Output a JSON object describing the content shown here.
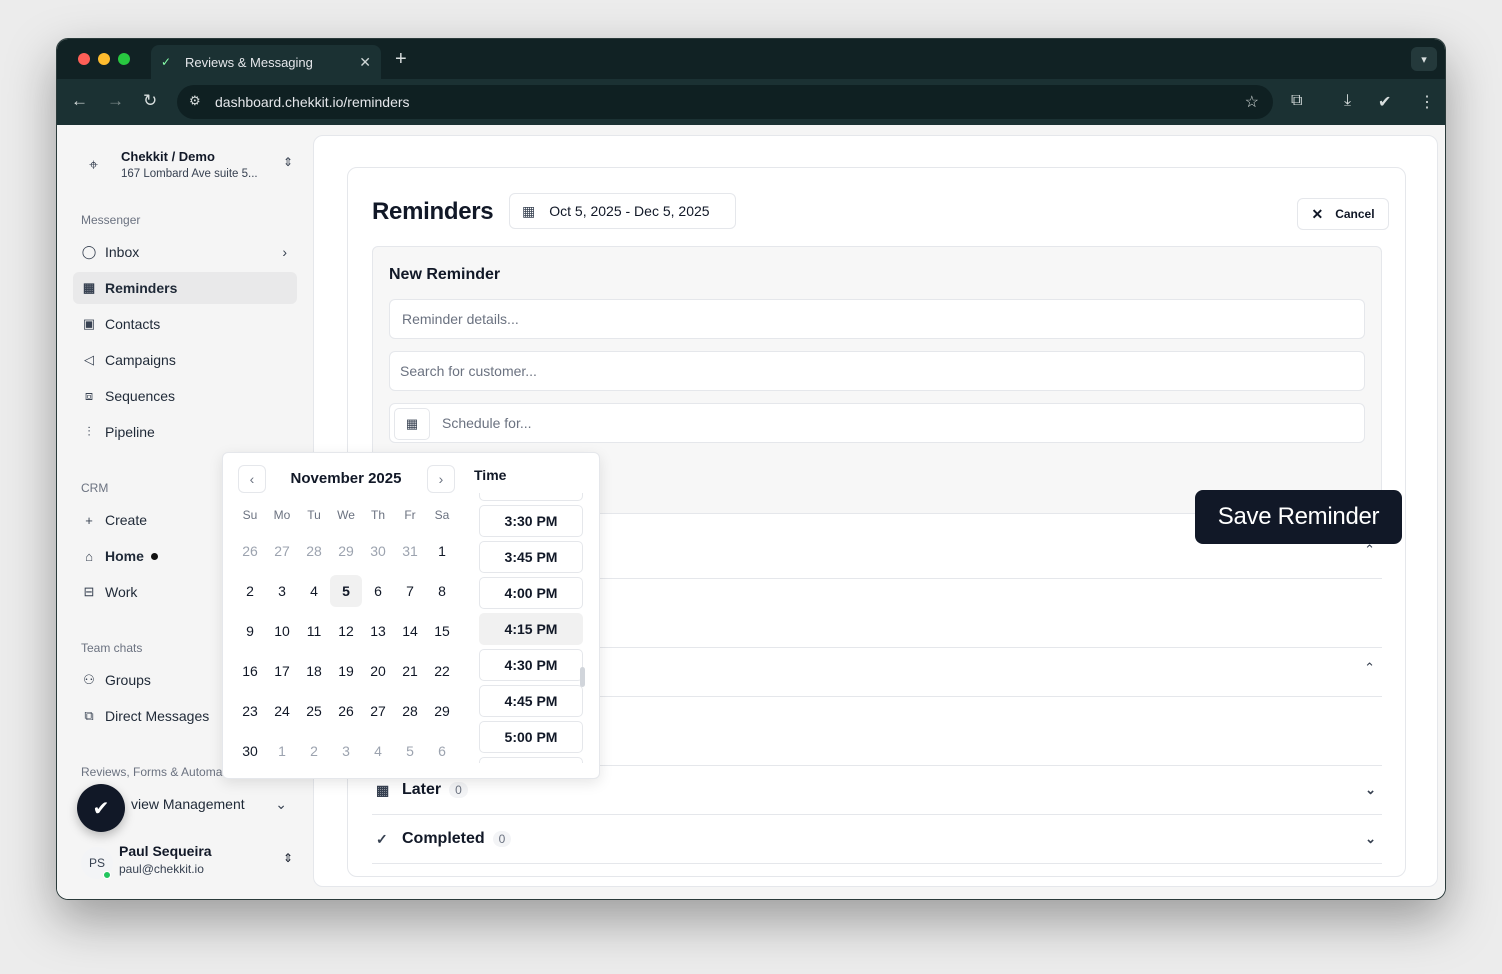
{
  "browser": {
    "tab_title": "Reviews & Messaging",
    "url": "dashboard.chekkit.io/reminders",
    "traffic_light_colors": [
      "#ff5f57",
      "#febc2e",
      "#28c840"
    ]
  },
  "sidebar": {
    "org_name": "Chekkit / Demo",
    "org_address": "167 Lombard Ave suite 5...",
    "messenger_label": "Messenger",
    "messenger_items": [
      {
        "label": "Inbox"
      },
      {
        "label": "Reminders"
      },
      {
        "label": "Contacts"
      },
      {
        "label": "Campaigns"
      },
      {
        "label": "Sequences"
      },
      {
        "label": "Pipeline"
      }
    ],
    "crm_label": "CRM",
    "crm_items": [
      {
        "label": "Create"
      },
      {
        "label": "Home"
      },
      {
        "label": "Work"
      }
    ],
    "team_label": "Team chats",
    "team_items": [
      {
        "label": "Groups"
      },
      {
        "label": "Direct Messages"
      }
    ],
    "reviews_label": "Reviews, Forms & Automa",
    "review_item": "view Management",
    "user": {
      "initials": "PS",
      "name": "Paul Sequeira",
      "email": "paul@chekkit.io"
    }
  },
  "main": {
    "title": "Reminders",
    "date_range": "Oct 5, 2025 - Dec 5, 2025",
    "cancel_label": "Cancel",
    "new_reminder": {
      "heading": "New Reminder",
      "details_placeholder": "Reminder details...",
      "customer_placeholder": "Search for customer...",
      "schedule_placeholder": "Schedule for..."
    },
    "save_label": "Save Reminder",
    "groups": [
      {
        "label": "Later",
        "count": "0"
      },
      {
        "label": "Completed",
        "count": "0"
      }
    ]
  },
  "datepicker": {
    "month_label": "November 2025",
    "weekdays": [
      "Su",
      "Mo",
      "Tu",
      "We",
      "Th",
      "Fr",
      "Sa"
    ],
    "weeks": [
      [
        "26",
        "27",
        "28",
        "29",
        "30",
        "31",
        "1"
      ],
      [
        "2",
        "3",
        "4",
        "5",
        "6",
        "7",
        "8"
      ],
      [
        "9",
        "10",
        "11",
        "12",
        "13",
        "14",
        "15"
      ],
      [
        "16",
        "17",
        "18",
        "19",
        "20",
        "21",
        "22"
      ],
      [
        "23",
        "24",
        "25",
        "26",
        "27",
        "28",
        "29"
      ],
      [
        "30",
        "1",
        "2",
        "3",
        "4",
        "5",
        "6"
      ]
    ],
    "today": "5",
    "time_label": "Time",
    "times": [
      "3:30 PM",
      "3:45 PM",
      "4:00 PM",
      "4:15 PM",
      "4:30 PM",
      "4:45 PM",
      "5:00 PM"
    ],
    "hovered_time": "4:15 PM"
  }
}
